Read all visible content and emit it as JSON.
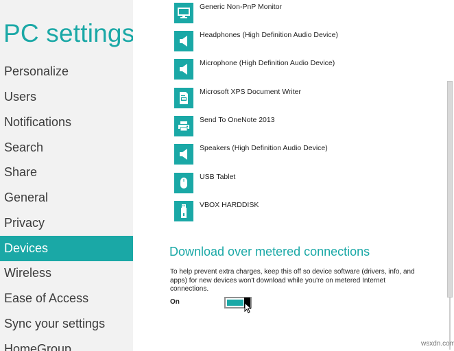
{
  "sidebar": {
    "title": "PC settings",
    "items": [
      {
        "label": "Personalize"
      },
      {
        "label": "Users"
      },
      {
        "label": "Notifications"
      },
      {
        "label": "Search"
      },
      {
        "label": "Share"
      },
      {
        "label": "General"
      },
      {
        "label": "Privacy"
      },
      {
        "label": "Devices",
        "active": true
      },
      {
        "label": "Wireless"
      },
      {
        "label": "Ease of Access"
      },
      {
        "label": "Sync your settings"
      },
      {
        "label": "HomeGroup"
      }
    ]
  },
  "devices": [
    {
      "name": "Generic Non-PnP Monitor",
      "icon": "monitor-icon"
    },
    {
      "name": "Headphones (High Definition Audio Device)",
      "icon": "speaker-icon"
    },
    {
      "name": "Microphone (High Definition Audio Device)",
      "icon": "speaker-icon"
    },
    {
      "name": "Microsoft XPS Document Writer",
      "icon": "document-printer-icon"
    },
    {
      "name": "Send To OneNote 2013",
      "icon": "printer-icon"
    },
    {
      "name": "Speakers (High Definition Audio Device)",
      "icon": "speaker-icon"
    },
    {
      "name": "USB Tablet",
      "icon": "mouse-icon"
    },
    {
      "name": "VBOX HARDDISK",
      "icon": "usb-drive-icon"
    }
  ],
  "metered": {
    "heading": "Download over metered connections",
    "description": "To help prevent extra charges, keep this off so device software (drivers, info, and apps) for new devices won't download while you're on metered Internet connections.",
    "toggle_state": "On",
    "toggle_on": true
  },
  "watermark": "wsxdn.com",
  "colors": {
    "accent": "#1aa8a6",
    "sidebar_bg": "#f2f2f2",
    "text": "#1e1e1e"
  }
}
